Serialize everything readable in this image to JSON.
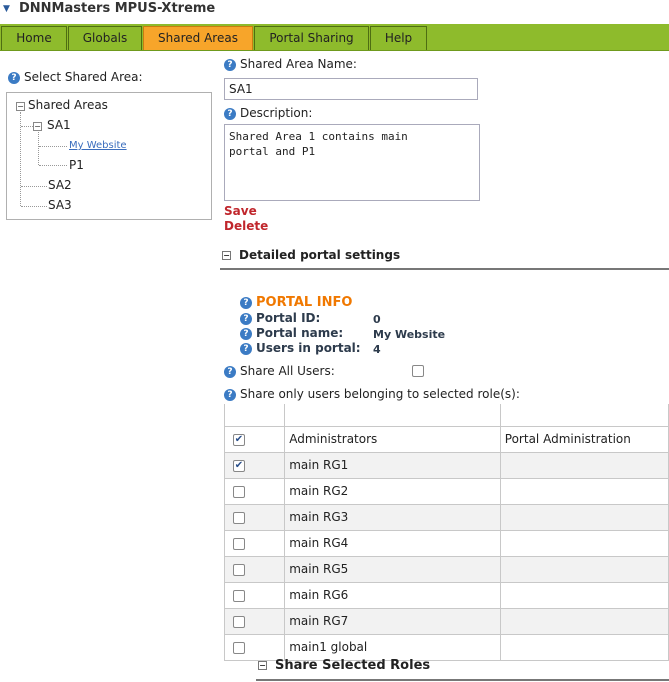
{
  "window": {
    "title": "DNNMasters MPUS-Xtreme"
  },
  "tabs": [
    {
      "label": "Home",
      "active": false
    },
    {
      "label": "Globals",
      "active": false
    },
    {
      "label": "Shared Areas",
      "active": true
    },
    {
      "label": "Portal Sharing",
      "active": false
    },
    {
      "label": "Help",
      "active": false
    }
  ],
  "left": {
    "select_label": "Select Shared Area:",
    "tree": {
      "root": "Shared Areas",
      "sa1": "SA1",
      "sa1_child1": "My Website",
      "sa1_child2": "P1",
      "sa2": "SA2",
      "sa3": "SA3"
    }
  },
  "form": {
    "name_label": "Shared Area Name:",
    "name_value": "SA1",
    "desc_label": "Description:",
    "desc_value": "Shared Area 1 contains main\nportal and P1",
    "save": "Save",
    "delete": "Delete"
  },
  "detailed": {
    "heading": "Detailed portal settings",
    "portal_info_title": "PORTAL INFO",
    "portal_id_label": "Portal ID:",
    "portal_id_value": "0",
    "portal_name_label": "Portal name:",
    "portal_name_value": "My Website",
    "users_label": "Users in portal:",
    "users_value": "4",
    "share_all_label": "Share All Users:",
    "share_roles_label": "Share only users belonging to selected role(s):"
  },
  "roles_table": {
    "rows": [
      {
        "role": "Administrators",
        "extra": "Portal Administration",
        "checked": true
      },
      {
        "role": "main RG1",
        "extra": "",
        "checked": true
      },
      {
        "role": "main RG2",
        "extra": "",
        "checked": false
      },
      {
        "role": "main RG3",
        "extra": "",
        "checked": false
      },
      {
        "role": "main RG4",
        "extra": "",
        "checked": false
      },
      {
        "role": "main RG5",
        "extra": "",
        "checked": false
      },
      {
        "role": "main RG6",
        "extra": "",
        "checked": false
      },
      {
        "role": "main RG7",
        "extra": "",
        "checked": false
      },
      {
        "role": "main1 global",
        "extra": "",
        "checked": false
      }
    ]
  },
  "share_selected": {
    "heading": "Share Selected Roles"
  },
  "colors": {
    "tab_bar": "#8ebb2c",
    "active_tab": "#f7a52a",
    "accent_orange": "#f07800",
    "link_red": "#c0262c"
  }
}
